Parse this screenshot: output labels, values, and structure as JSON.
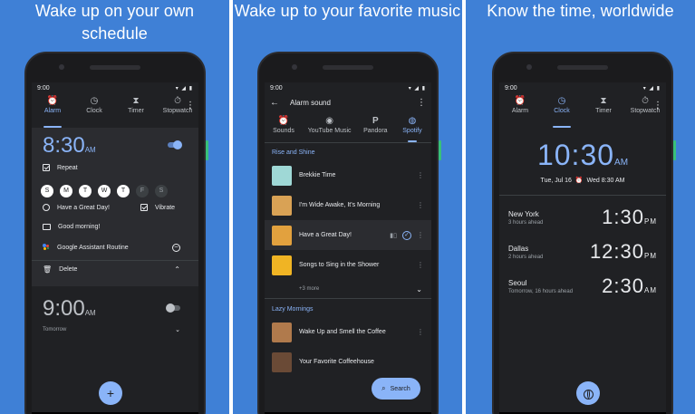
{
  "panels": [
    {
      "heading": "Wake up on your own schedule",
      "status_time": "9:00",
      "tabs": [
        {
          "label": "Alarm",
          "icon": "alarm-icon",
          "active": true
        },
        {
          "label": "Clock",
          "icon": "clock-icon",
          "active": false
        },
        {
          "label": "Timer",
          "icon": "hourglass-icon",
          "active": false
        },
        {
          "label": "Stopwatch",
          "icon": "stopwatch-icon",
          "active": false
        }
      ],
      "alarm1": {
        "time": "8:30",
        "ampm": "AM",
        "enabled": true,
        "repeat_label": "Repeat",
        "days": [
          "S",
          "M",
          "T",
          "W",
          "T",
          "F",
          "S"
        ],
        "days_active": [
          true,
          true,
          true,
          true,
          true,
          false,
          false
        ],
        "sound_label": "Have a Great Day!",
        "vibrate_label": "Vibrate",
        "label_text": "Good morning!",
        "assistant_label": "Google Assistant Routine",
        "delete_label": "Delete"
      },
      "alarm2": {
        "time": "9:00",
        "ampm": "AM",
        "enabled": false,
        "sub": "Tomorrow"
      },
      "fab_icon": "add-icon",
      "fab_symbol": "+"
    },
    {
      "heading": "Wake up to your favorite music",
      "status_time": "9:00",
      "title": "Alarm sound",
      "sources": [
        {
          "label": "Sounds",
          "icon": "alarm-icon",
          "active": false
        },
        {
          "label": "YouTube Music",
          "icon": "youtube-music-icon",
          "active": false
        },
        {
          "label": "Pandora",
          "icon": "pandora-icon",
          "active": false
        },
        {
          "label": "Spotify",
          "icon": "spotify-icon",
          "active": true
        }
      ],
      "section1": "Rise and Shine",
      "songs1": [
        {
          "name": "Brekkie Time",
          "color": "#9fd8d6"
        },
        {
          "name": "I'm Wide Awake, It's Morning",
          "color": "#d9a255"
        },
        {
          "name": "Have a Great Day!",
          "color": "#e2a13e",
          "selected": true
        },
        {
          "name": "Songs to Sing in the Shower",
          "color": "#f0b424"
        }
      ],
      "more_label": "+3 more",
      "section2": "Lazy Mornings",
      "songs2": [
        {
          "name": "Wake Up and Smell the Coffee",
          "color": "#b07a4c"
        },
        {
          "name": "Your Favorite Coffeehouse",
          "color": "#6a4a36"
        }
      ],
      "search_label": "Search"
    },
    {
      "heading": "Know the time, worldwide",
      "status_time": "9:00",
      "tabs": [
        {
          "label": "Alarm",
          "icon": "alarm-icon",
          "active": false
        },
        {
          "label": "Clock",
          "icon": "clock-icon",
          "active": true
        },
        {
          "label": "Timer",
          "icon": "hourglass-icon",
          "active": false
        },
        {
          "label": "Stopwatch",
          "icon": "stopwatch-icon",
          "active": false
        }
      ],
      "main_time": "10:30",
      "main_ampm": "AM",
      "date": "Tue, Jul 16",
      "next_alarm": "Wed 8:30 AM",
      "cities": [
        {
          "name": "New York",
          "sub": "3 hours ahead",
          "time": "1:30",
          "ampm": "PM"
        },
        {
          "name": "Dallas",
          "sub": "2 hours ahead",
          "time": "12:30",
          "ampm": "PM"
        },
        {
          "name": "Seoul",
          "sub": "Tomorrow, 16 hours ahead",
          "time": "2:30",
          "ampm": "AM"
        }
      ],
      "fab_icon": "globe-icon"
    }
  ],
  "colors": {
    "background": "#3f80d6",
    "accent": "#8ab4f8",
    "screen": "#202124"
  }
}
